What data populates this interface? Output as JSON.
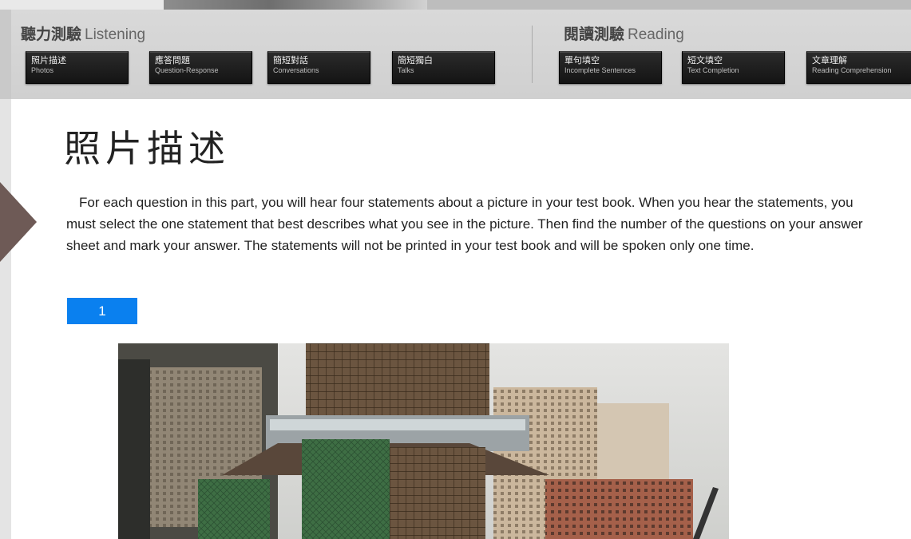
{
  "listening": {
    "title_zh": "聽力測驗",
    "title_en": "Listening",
    "items": [
      {
        "zh": "照片描述",
        "en": "Photos"
      },
      {
        "zh": "應答問題",
        "en": "Question-Response"
      },
      {
        "zh": "簡短對話",
        "en": "Conversations"
      },
      {
        "zh": "簡短獨白",
        "en": "Talks"
      }
    ]
  },
  "reading": {
    "title_zh": "閱讀測驗",
    "title_en": "Reading",
    "items": [
      {
        "zh": "單句填空",
        "en": "Incomplete Sentences"
      },
      {
        "zh": "短文填空",
        "en": "Text Completion"
      },
      {
        "zh": "文章理解",
        "en": "Reading Comprehension"
      }
    ]
  },
  "main": {
    "heading": "照片描述",
    "instructions": "For each question in this part, you will hear four statements about a picture in your test book. When you hear the statements, you must select the one statement that best describes what you see in the picture. Then find the number of the questions on your answer sheet and mark your answer. The statements will not be printed in your test book and will be spoken only one time.",
    "question_number": "1"
  },
  "colors": {
    "accent": "#0a80ef",
    "nav_bg": "#d4d4d4",
    "button_bg": "#1c1c1c"
  }
}
